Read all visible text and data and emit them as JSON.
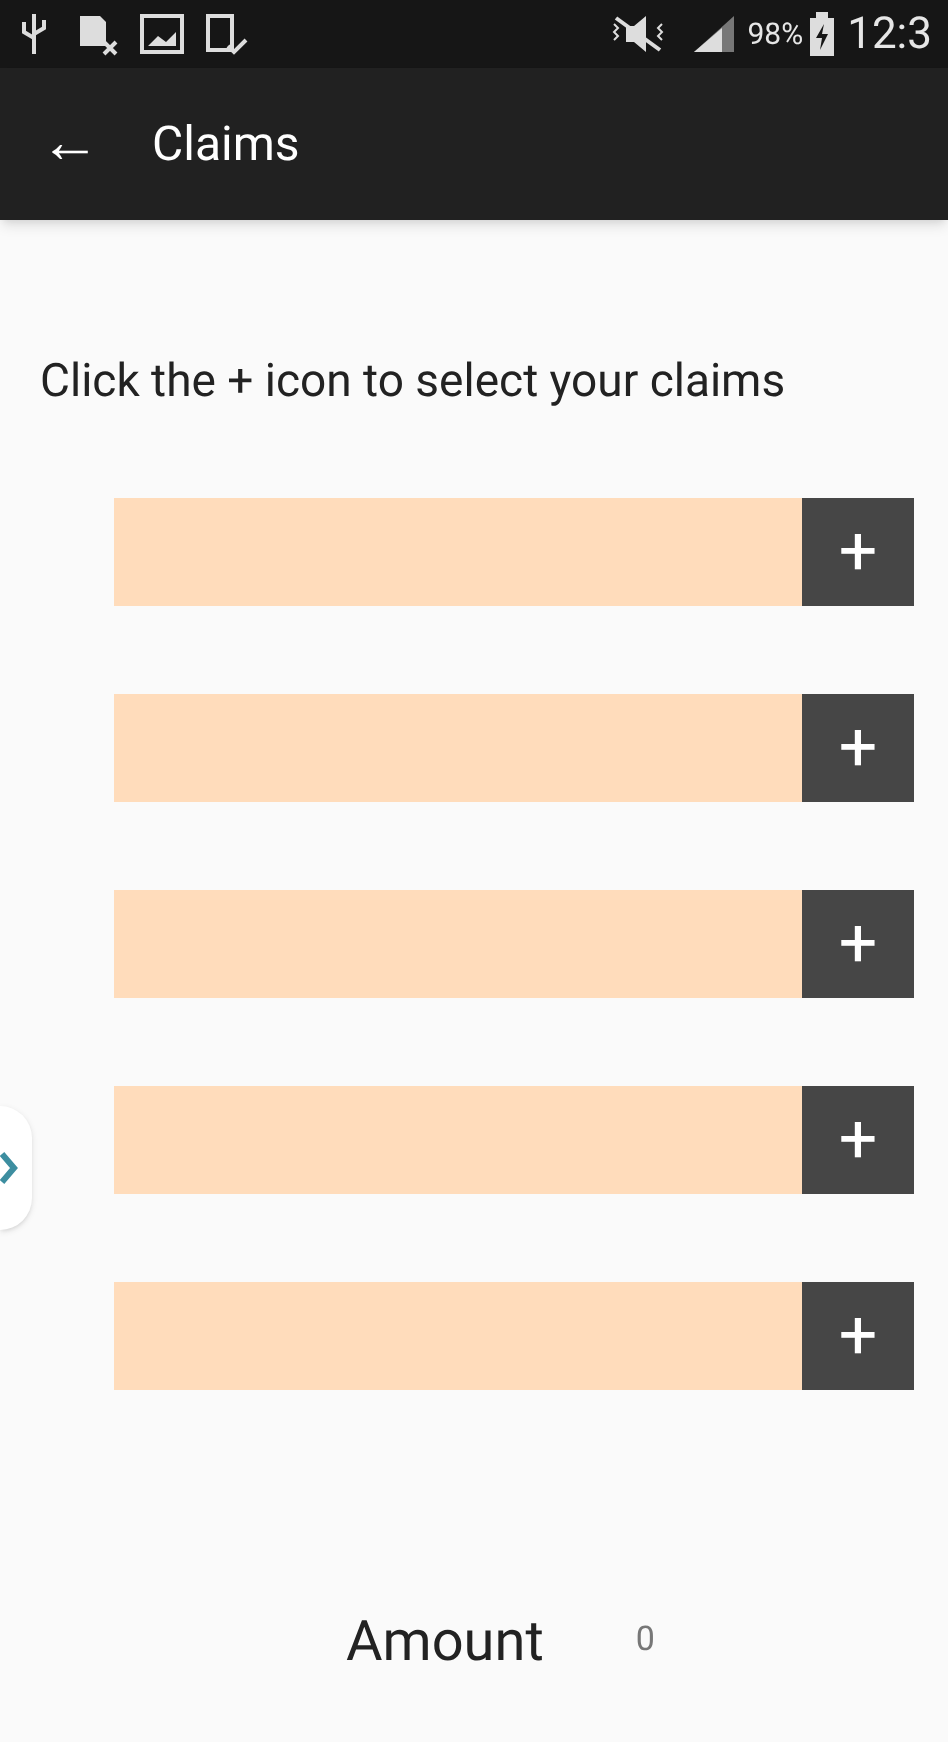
{
  "status_bar": {
    "battery": "98%",
    "time": "12:3"
  },
  "app_bar": {
    "back": "←",
    "title": "Claims"
  },
  "instruction": "Click the + icon to select your claims",
  "claims": [
    {
      "kind": "empty",
      "add": "+"
    },
    {
      "kind": "empty",
      "add": "+"
    },
    {
      "kind": "empty",
      "add": "+"
    },
    {
      "kind": "empty",
      "add": "+"
    },
    {
      "kind": "empty",
      "add": "+"
    }
  ],
  "amount": {
    "label": "Amount",
    "value": "0"
  }
}
